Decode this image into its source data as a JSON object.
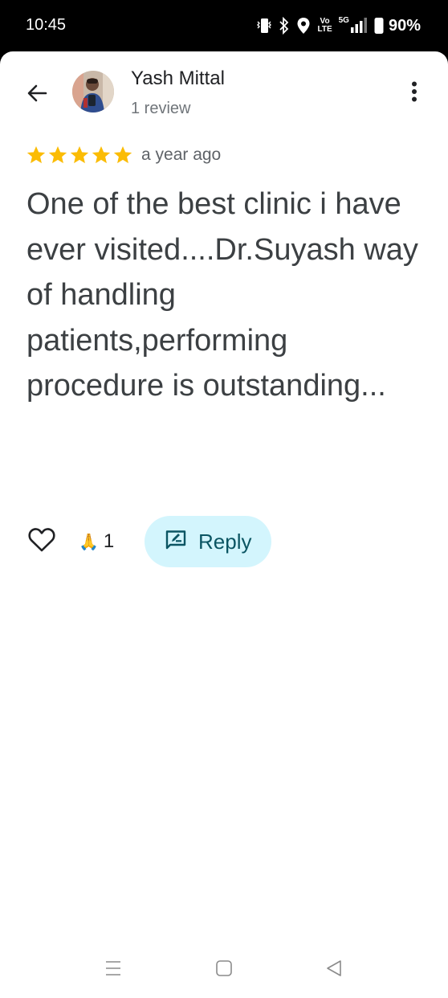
{
  "status_bar": {
    "time": "10:45",
    "network_volte_top": "Vo",
    "network_volte_bottom": "LTE",
    "network_type": "5G",
    "battery_percent": "90%"
  },
  "header": {
    "reviewer_name": "Yash Mittal",
    "reviewer_subtitle": "1 review"
  },
  "review": {
    "rating": 5,
    "rating_max": 5,
    "star_color": "#fbbc04",
    "time_ago": "a year ago",
    "text": "One of the best clinic i have ever visited....Dr.Suyash way of handling patients,performing procedure is outstanding..."
  },
  "actions": {
    "reaction_emoji": "🙏",
    "reaction_count": "1",
    "reply_label": "Reply",
    "reply_bg_color": "#d3f5fd"
  },
  "icons": {
    "back": "arrow-left-icon",
    "more": "more-vert-icon",
    "like": "heart-outline-icon",
    "reply": "rate-review-icon"
  }
}
